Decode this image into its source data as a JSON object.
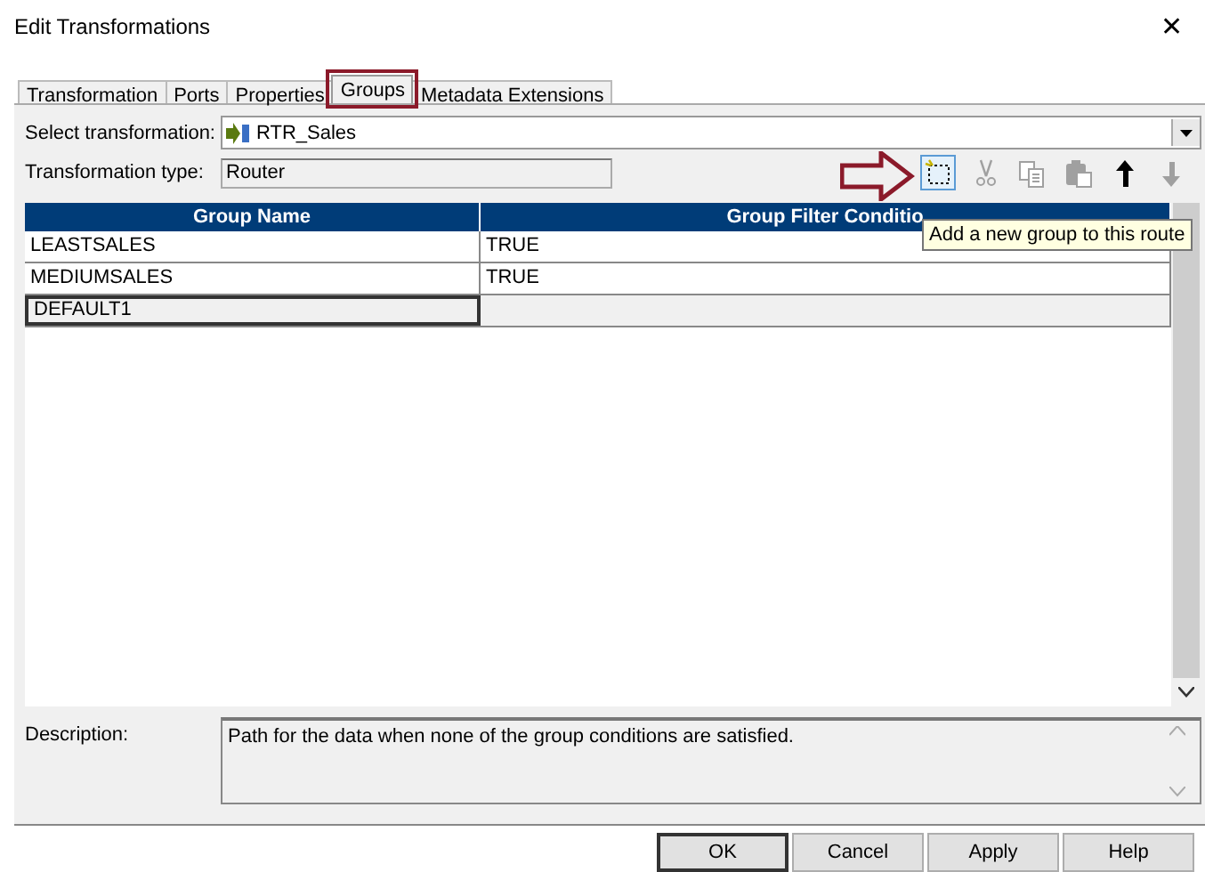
{
  "window": {
    "title": "Edit Transformations",
    "close": "✕"
  },
  "tabs": [
    {
      "label": "Transformation",
      "selected": false,
      "highlighted": false
    },
    {
      "label": "Ports",
      "selected": false,
      "highlighted": false
    },
    {
      "label": "Properties",
      "selected": false,
      "highlighted": false
    },
    {
      "label": "Groups",
      "selected": true,
      "highlighted": true
    },
    {
      "label": "Metadata Extensions",
      "selected": false,
      "highlighted": false
    }
  ],
  "select_transformation": {
    "label": "Select transformation:",
    "value": "RTR_Sales"
  },
  "transformation_type": {
    "label": "Transformation type:",
    "value": "Router"
  },
  "toolbar": [
    {
      "kind": "new",
      "disabled": false,
      "hovered": true
    },
    {
      "kind": "cut",
      "disabled": true,
      "hovered": false
    },
    {
      "kind": "copy",
      "disabled": true,
      "hovered": false
    },
    {
      "kind": "paste",
      "disabled": true,
      "hovered": false
    },
    {
      "kind": "up",
      "disabled": false,
      "hovered": false
    },
    {
      "kind": "down",
      "disabled": true,
      "hovered": false
    }
  ],
  "tooltip": "Add a new group to this route",
  "table": {
    "columns": [
      "Group Name",
      "Group Filter Conditio"
    ],
    "rows": [
      {
        "cells": [
          "LEASTSALES",
          "TRUE"
        ],
        "selected": false
      },
      {
        "cells": [
          "MEDIUMSALES",
          "TRUE"
        ],
        "selected": false
      },
      {
        "cells": [
          "DEFAULT1"
        ],
        "selected": true
      }
    ]
  },
  "description": {
    "label": "Description:",
    "value": "Path for the data when none of the group conditions are satisfied."
  },
  "buttons": [
    "OK",
    "Cancel",
    "Apply",
    "Help"
  ]
}
